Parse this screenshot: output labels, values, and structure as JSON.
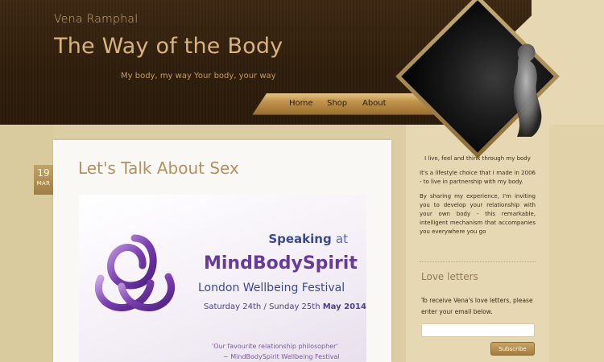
{
  "header": {
    "author": "Vena Ramphal",
    "title": "The Way of the Body",
    "tagline": "My body, my way Your body, your way",
    "nav": [
      {
        "label": "Home"
      },
      {
        "label": "Shop"
      },
      {
        "label": "About"
      }
    ]
  },
  "post": {
    "date_day": "19",
    "date_month": "MAR",
    "title": "Let's Talk About Sex",
    "promo": {
      "speaking": "Speaking",
      "at": "at",
      "event": "MindBodySpirit",
      "festival": "London Wellbeing Festival",
      "dates_plain": "Saturday 24th / Sunday 25th",
      "dates_bold": "May 2014",
      "quote": "'Our favourite relationship philosopher'",
      "quote_source": "~ MindBodySpirit Wellbeing Festival"
    }
  },
  "sidebar": {
    "intro": [
      "I live, feel and think through my body",
      "It's a lifestyle choice that I made in 2006 - to live in partnership with my body.",
      "By sharing my experience, I'm inviting you to develop your relationship with your own body - this remarkable, intelligent mechanism that accompanies you everywhere you go"
    ],
    "love_heading": "Love letters",
    "love_text": "To receive Vena's love letters, please enter your email below.",
    "email_value": "",
    "email_placeholder": "",
    "subscribe_label": "Subscribe"
  },
  "colors": {
    "header_bg": "#2e1d0b",
    "accent_gold": "#b88a44",
    "title_color": "#d8b382",
    "promo_purple": "#6a3b96",
    "promo_blue": "#3a4a8a"
  }
}
